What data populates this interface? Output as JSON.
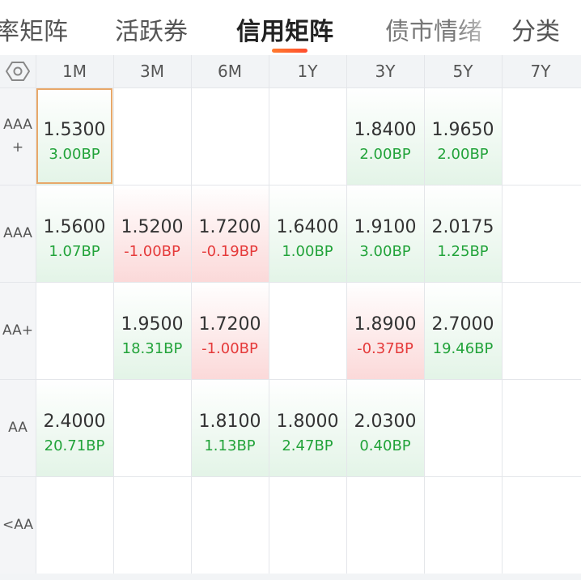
{
  "tabs": [
    {
      "label": "率矩阵",
      "active": false
    },
    {
      "label": "活跃券",
      "active": false
    },
    {
      "label": "信用矩阵",
      "active": true
    },
    {
      "label": "债市情绪",
      "active": false
    },
    {
      "label": "分类",
      "active": false
    }
  ],
  "settings_icon": "hexagon-gear-icon",
  "columns": [
    "1M",
    "3M",
    "6M",
    "1Y",
    "3Y",
    "5Y",
    "7Y"
  ],
  "rows": [
    {
      "label": "AAA\n+",
      "cells": [
        {
          "value": "1.5300",
          "change": "3.00BP",
          "dir": "up",
          "selected": true
        },
        null,
        null,
        null,
        {
          "value": "1.8400",
          "change": "2.00BP",
          "dir": "up"
        },
        {
          "value": "1.9650",
          "change": "2.00BP",
          "dir": "up"
        },
        null
      ]
    },
    {
      "label": "AAA",
      "cells": [
        {
          "value": "1.5600",
          "change": "1.07BP",
          "dir": "up"
        },
        {
          "value": "1.5200",
          "change": "-1.00BP",
          "dir": "down"
        },
        {
          "value": "1.7200",
          "change": "-0.19BP",
          "dir": "down"
        },
        {
          "value": "1.6400",
          "change": "1.00BP",
          "dir": "up"
        },
        {
          "value": "1.9100",
          "change": "3.00BP",
          "dir": "up"
        },
        {
          "value": "2.0175",
          "change": "1.25BP",
          "dir": "up"
        },
        null
      ]
    },
    {
      "label": "AA+",
      "cells": [
        null,
        {
          "value": "1.9500",
          "change": "18.31BP",
          "dir": "up"
        },
        {
          "value": "1.7200",
          "change": "-1.00BP",
          "dir": "down"
        },
        null,
        {
          "value": "1.8900",
          "change": "-0.37BP",
          "dir": "down"
        },
        {
          "value": "2.7000",
          "change": "19.46BP",
          "dir": "up"
        },
        null
      ]
    },
    {
      "label": "AA",
      "cells": [
        {
          "value": "2.4000",
          "change": "20.71BP",
          "dir": "up"
        },
        null,
        {
          "value": "1.8100",
          "change": "1.13BP",
          "dir": "up"
        },
        {
          "value": "1.8000",
          "change": "2.47BP",
          "dir": "up"
        },
        {
          "value": "2.0300",
          "change": "0.40BP",
          "dir": "up"
        },
        null,
        null
      ]
    },
    {
      "label": "<AA",
      "cells": [
        null,
        null,
        null,
        null,
        null,
        null,
        null
      ]
    }
  ],
  "colors": {
    "up": "#22a33a",
    "down": "#e53a3a",
    "accent": "#ff6a2e"
  }
}
